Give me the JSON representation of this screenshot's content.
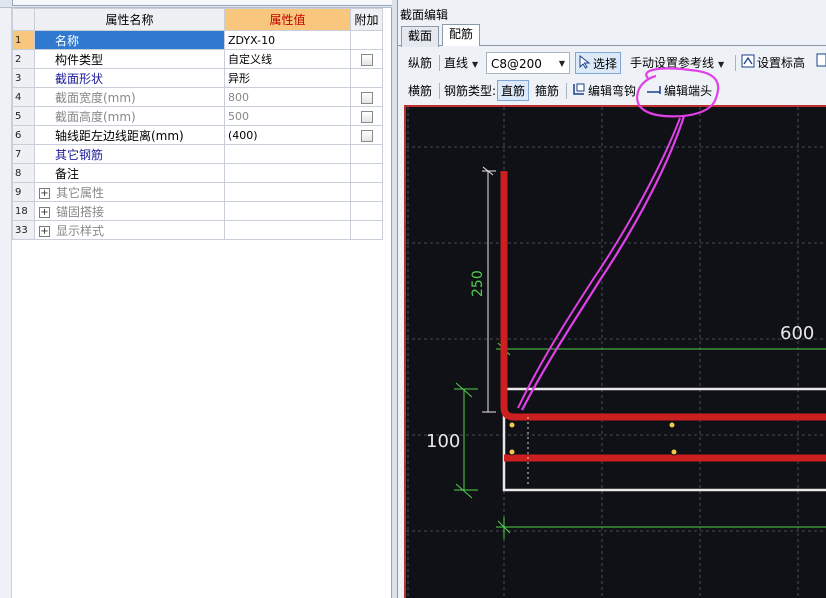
{
  "property_grid": {
    "headers": {
      "name": "属性名称",
      "value": "属性值",
      "extra": "附加"
    },
    "rows": [
      {
        "num": "1",
        "name": "名称",
        "value": "ZDYX-10",
        "checkbox": false,
        "style": "blue",
        "selected": true
      },
      {
        "num": "2",
        "name": "构件类型",
        "value": "自定义线",
        "checkbox": true,
        "style": "normal"
      },
      {
        "num": "3",
        "name": "截面形状",
        "value": "异形",
        "checkbox": false,
        "style": "blue"
      },
      {
        "num": "4",
        "name": "截面宽度(mm)",
        "value": "800",
        "checkbox": true,
        "style": "gray"
      },
      {
        "num": "5",
        "name": "截面高度(mm)",
        "value": "500",
        "checkbox": true,
        "style": "gray"
      },
      {
        "num": "6",
        "name": "轴线距左边线距离(mm)",
        "value": "(400)",
        "checkbox": true,
        "style": "normal"
      },
      {
        "num": "7",
        "name": "其它钢筋",
        "value": "",
        "checkbox": false,
        "style": "blue"
      },
      {
        "num": "8",
        "name": "备注",
        "value": "",
        "checkbox": false,
        "style": "normal"
      },
      {
        "num": "9",
        "name": "其它属性",
        "value": "",
        "checkbox": false,
        "style": "gray",
        "expander": "+"
      },
      {
        "num": "18",
        "name": "锚固搭接",
        "value": "",
        "checkbox": false,
        "style": "gray",
        "expander": "+"
      },
      {
        "num": "33",
        "name": "显示样式",
        "value": "",
        "checkbox": false,
        "style": "gray",
        "expander": "+"
      }
    ]
  },
  "section_editor": {
    "title": "截面编辑",
    "tabs": {
      "section": "截面",
      "rebar": "配筋"
    },
    "toolbar1": {
      "longitudinal": "纵筋",
      "line_mode": "直线",
      "rebar_spec": "C8@200",
      "select": "选择",
      "ref_line": "手动设置参考线",
      "set_elevation": "设置标高"
    },
    "toolbar2": {
      "transverse": "横筋",
      "rebar_type_label": "钢筋类型:",
      "straight": "直筋",
      "stirrup": "箍筋",
      "edit_bend": "编辑弯钩",
      "edit_end": "编辑端头"
    },
    "dimensions": {
      "vertical": "250",
      "horizontal": "600",
      "height": "100"
    }
  },
  "colors": {
    "canvas_bg": "#101116",
    "rebar_red": "#cc1f1f",
    "dim_green": "#4fd14f",
    "annotation_magenta": "#e040e8",
    "selected_blue": "#2f79d0",
    "header_orange": "#f8c67c",
    "rebar_point_yellow": "#f2c84b"
  },
  "icons": {
    "select": "cursor-arrow-icon",
    "set_elevation": "elevation-icon",
    "edit_bend": "bend-hook-icon",
    "edit_end": "rebar-end-icon"
  }
}
